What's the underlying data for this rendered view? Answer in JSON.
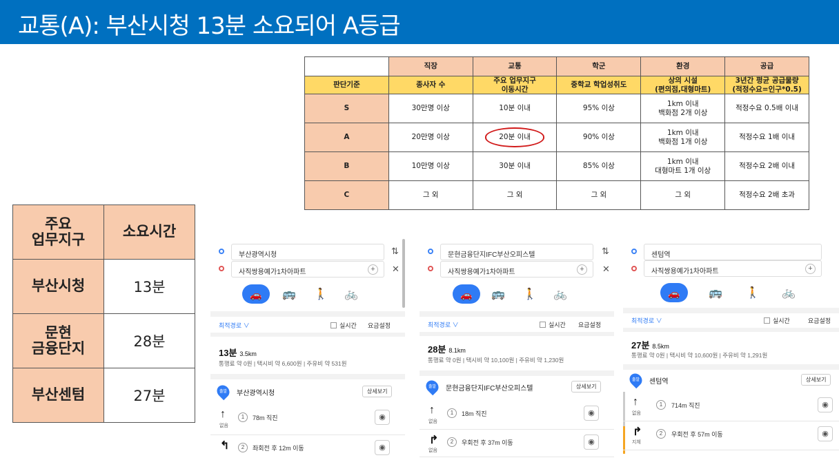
{
  "title": "교통(A): 부산시청 13분 소요되어 A등급",
  "criteria_table": {
    "headers": [
      "",
      "직장",
      "교통",
      "학군",
      "환경",
      "공급"
    ],
    "subheader": [
      "판단기준",
      "종사자 수",
      "주요 업무지구\n이동시간",
      "중학교 학업성취도",
      "상의 시설\n(편의점,대형마트)",
      "3년간 평균 공급물량\n(적정수요=인구*0.5)"
    ],
    "rows": [
      [
        "S",
        "30만명 이상",
        "10분 이내",
        "95% 이상",
        "1km 이내\n백화점 2개 이상",
        "적정수요 0.5배 이내"
      ],
      [
        "A",
        "20만명 이상",
        "20분 이내",
        "90% 이상",
        "1km 이내\n백화점 1개 이상",
        "적정수요 1배 이내"
      ],
      [
        "B",
        "10만명 이상",
        "30분 이내",
        "85% 이상",
        "1km 이내\n대형마트 1개 이상",
        "적정수요 2배 이내"
      ],
      [
        "C",
        "그 외",
        "그 외",
        "그 외",
        "그 외",
        "적정수요 2배 초과"
      ]
    ],
    "highlight_color": "#d11a1a"
  },
  "summary_table": {
    "headers": [
      "주요\n업무지구",
      "소요시간"
    ],
    "rows": [
      [
        "부산시청",
        "13분"
      ],
      [
        "문현\n금융단지",
        "28분"
      ],
      [
        "부산센텀",
        "27분"
      ]
    ]
  },
  "panels": [
    {
      "origin": "부산광역시청",
      "destination": "사직쌍용예가1차아파트",
      "route_option": "최적경로 ∨",
      "realtime": "실시간",
      "fare_setting": "요금설정",
      "time": "13분",
      "distance": "3.5km",
      "fees": "통행료 약 0원 | 택시비 약 6,600원 | 주유비 약 531원",
      "start_badge": "출발",
      "start_name": "부산광역시청",
      "detail_label": "상세보기",
      "steps": [
        {
          "icon": "↑",
          "sub": "없음",
          "num": "1",
          "text": "78m 직진"
        },
        {
          "icon": "↰",
          "sub": "",
          "num": "2",
          "text": "좌회전 후 12m 이동"
        }
      ]
    },
    {
      "origin": "문현금융단지IFC부산오피스텔",
      "destination": "사직쌍용예가1차아파트",
      "route_option": "최적경로 ∨",
      "realtime": "실시간",
      "fare_setting": "요금설정",
      "time": "28분",
      "distance": "8.1km",
      "fees": "통행료 약 0원 | 택시비 약 10,100원 | 주유비 약 1,230원",
      "start_badge": "출발",
      "start_name": "문현금융단지IFC부산오피스텔",
      "detail_label": "상세보기",
      "steps": [
        {
          "icon": "↑",
          "sub": "없음",
          "num": "1",
          "text": "18m 직진"
        },
        {
          "icon": "↱",
          "sub": "없음",
          "num": "2",
          "text": "우회전 후 37m 이동"
        }
      ]
    },
    {
      "origin": "센텀역",
      "destination": "사직쌍용예가1차아파트",
      "route_option": "최적경로 ∨",
      "realtime": "실시간",
      "fare_setting": "요금설정",
      "time": "27분",
      "distance": "8.5km",
      "fees": "통행료 약 0원 | 택시비 약 10,600원 | 주유비 약 1,291원",
      "start_badge": "출발",
      "start_name": "센텀역",
      "detail_label": "상세보기",
      "steps": [
        {
          "icon": "↑",
          "sub": "없음",
          "num": "1",
          "text": "714m 직진"
        },
        {
          "icon": "↱",
          "sub": "지체",
          "num": "2",
          "text": "우회전 후 57m 이동"
        }
      ]
    }
  ],
  "icons": {
    "car": "car-icon",
    "bus": "bus-icon",
    "walk": "walk-icon",
    "bike": "bike-icon",
    "swap": "swap-icon",
    "close": "close-icon",
    "cctv": "cctv-icon"
  },
  "colors": {
    "header_bg": "#0070c0",
    "header_fg": "#ffffff",
    "table_head": "#f8cbad",
    "table_subhead": "#ffd966",
    "accent": "#2f7bf5"
  }
}
